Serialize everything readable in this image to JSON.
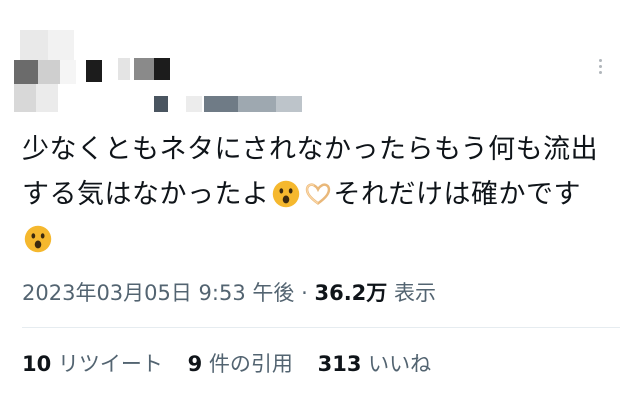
{
  "tweet": {
    "text_part1": "少なくともネタにされなかったらもう何も流出する気はなかったよ",
    "text_part2": "それだけは確かです",
    "emojis": [
      "hushed-face-icon",
      "heart-hands-icon",
      "hushed-face-icon"
    ],
    "timestamp": "2023年03月05日 9:53 午後",
    "separator": "·",
    "views_count": "36.2万",
    "views_label": "表示",
    "retweets_count": "10",
    "retweets_label": "リツイート",
    "quotes_count": "9",
    "quotes_label": "件の引用",
    "likes_count": "313",
    "likes_label": "いいね"
  },
  "colors": {
    "text": "#0f1419",
    "secondary": "#536471",
    "divider": "#e6ecf0",
    "emoji_face": "#f5b82e"
  }
}
